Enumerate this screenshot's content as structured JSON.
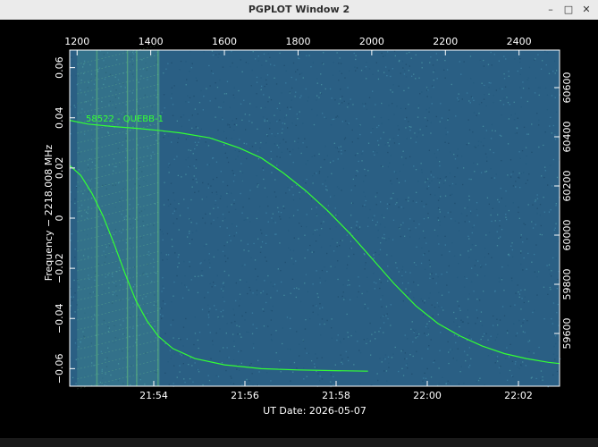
{
  "window": {
    "title": "PGPLOT Window 2",
    "minimize_icon": "minimize-icon",
    "maximize_icon": "maximize-icon",
    "close_icon": "close-icon"
  },
  "plot": {
    "background_color": "#2a5f84",
    "frame_color": "#ffffff",
    "curve_color": "#33ff33",
    "xlabel": "UT Date: 2026-05-07",
    "ylabel": "Frequency − 2218.008 MHz",
    "annotation": "58522 - QUEBB-1",
    "top_axis": {
      "ticks": [
        "1200",
        "1400",
        "1600",
        "1800",
        "2000",
        "2200",
        "2400"
      ]
    },
    "bottom_axis": {
      "ticks": [
        "21:54",
        "21:56",
        "21:58",
        "22:00",
        "22:02"
      ]
    },
    "left_axis": {
      "ticks": [
        "0.06",
        "0.04",
        "0.02",
        "0",
        "−0.02",
        "−0.04",
        "−0.06"
      ]
    },
    "right_axis": {
      "ticks": [
        "60600",
        "60400",
        "60200",
        "60000",
        "59800",
        "59600"
      ]
    }
  },
  "chart_data": {
    "type": "line",
    "title": "",
    "xlabel": "UT Date: 2026-05-07",
    "ylabel": "Frequency − 2218.008 MHz",
    "xlim_top": [
      1180,
      2510
    ],
    "ylim": [
      -0.067,
      0.067
    ],
    "series": [
      {
        "x": [
          1180,
          1230,
          1300,
          1360,
          1420,
          1480,
          1560,
          1640,
          1700,
          1760,
          1820,
          1880,
          1940,
          2000,
          2060,
          2120,
          2180,
          2240,
          2300,
          2360,
          2420,
          2480,
          2510
        ],
        "y": [
          0.039,
          0.0375,
          0.0365,
          0.0358,
          0.035,
          0.034,
          0.032,
          0.028,
          0.024,
          0.018,
          0.011,
          0.003,
          -0.006,
          -0.016,
          -0.026,
          -0.035,
          -0.042,
          -0.047,
          -0.051,
          -0.054,
          -0.056,
          -0.0575,
          -0.058
        ]
      },
      {
        "x": [
          1180,
          1210,
          1240,
          1270,
          1300,
          1330,
          1360,
          1390,
          1420,
          1460,
          1520,
          1600,
          1700,
          1800,
          1900,
          1990
        ],
        "y": [
          0.021,
          0.017,
          0.01,
          0.001,
          -0.01,
          -0.022,
          -0.033,
          -0.041,
          -0.047,
          -0.052,
          -0.056,
          -0.0585,
          -0.06,
          -0.0605,
          -0.0608,
          -0.061
        ]
      }
    ]
  }
}
